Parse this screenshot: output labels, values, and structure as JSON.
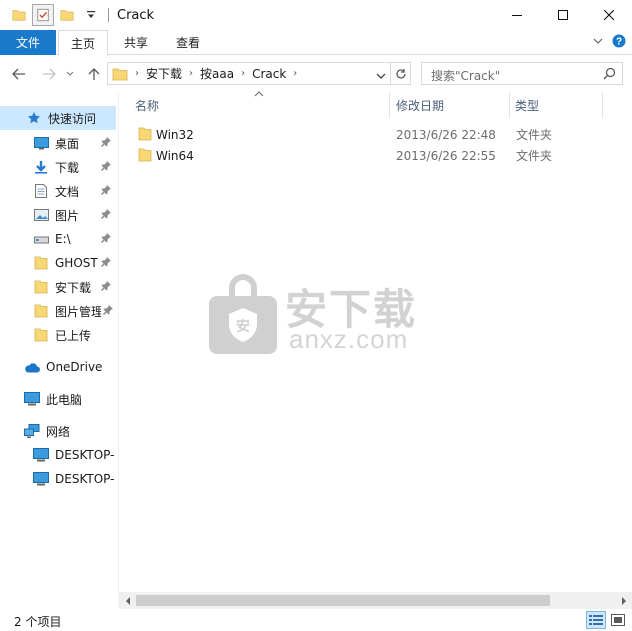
{
  "window": {
    "title": "Crack"
  },
  "ribbon": {
    "tabs": [
      {
        "label": "文件"
      },
      {
        "label": "主页"
      },
      {
        "label": "共享"
      },
      {
        "label": "查看"
      }
    ]
  },
  "address": {
    "crumbs": [
      "安下载",
      "按aaa",
      "Crack"
    ]
  },
  "search": {
    "placeholder": "搜索\"Crack\""
  },
  "sidebar": {
    "quick_access": "快速访问",
    "quick_items": [
      {
        "label": "桌面",
        "icon": "desktop-icon"
      },
      {
        "label": "下载",
        "icon": "download-icon"
      },
      {
        "label": "文档",
        "icon": "document-icon"
      },
      {
        "label": "图片",
        "icon": "pictures-icon"
      },
      {
        "label": "E:\\",
        "icon": "drive-icon"
      },
      {
        "label": "GHOST",
        "icon": "folder-icon"
      },
      {
        "label": "安下载",
        "icon": "folder-icon"
      },
      {
        "label": "图片管理",
        "icon": "folder-icon"
      },
      {
        "label": "已上传",
        "icon": "folder-icon"
      }
    ],
    "onedrive": "OneDrive",
    "this_pc": "此电脑",
    "network": "网络",
    "network_items": [
      {
        "label": "DESKTOP-"
      },
      {
        "label": "DESKTOP-"
      }
    ]
  },
  "columns": {
    "name": "名称",
    "date": "修改日期",
    "type": "类型"
  },
  "files": [
    {
      "name": "Win32",
      "date": "2013/6/26 22:48",
      "type": "文件夹"
    },
    {
      "name": "Win64",
      "date": "2013/6/26 22:55",
      "type": "文件夹"
    }
  ],
  "watermark": {
    "title": "安下载",
    "subtitle": "anxz.com"
  },
  "status": {
    "count": "2 个项目"
  },
  "colors": {
    "accent": "#1979ca",
    "selection": "#cce8ff",
    "folder": "#f8d775"
  }
}
